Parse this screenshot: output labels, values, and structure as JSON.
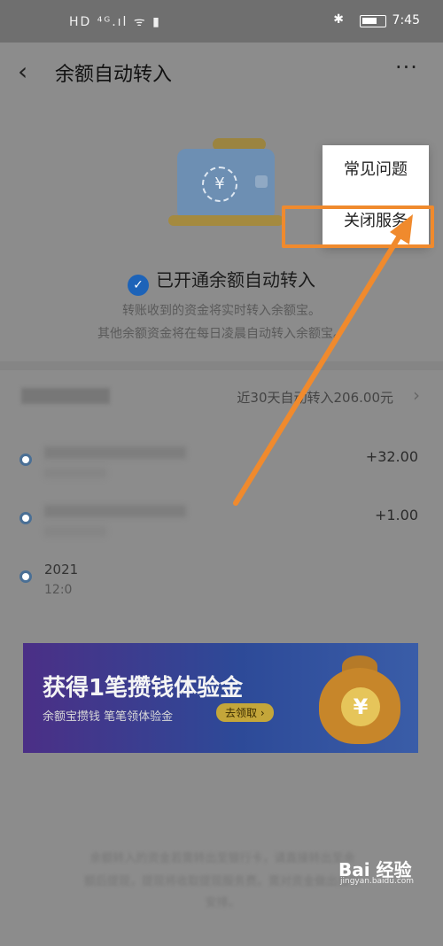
{
  "status_bar": {
    "left_icons": "HD ⁴ᴳ.ıl ᯤ ▮",
    "bluetooth_icon": "✱",
    "time": "7:45"
  },
  "nav": {
    "back_icon": "‹",
    "title": "余额自动转入",
    "more_icon": "···"
  },
  "hero": {
    "status_text": "已开通余额自动转入",
    "sub_line1": "转账收到的资金将实时转入余额宝。",
    "sub_line2": "其他余额资金将在每日凌晨自动转入余额宝。"
  },
  "summary": {
    "text": "近30天自动转入206.00元",
    "chevron": "›"
  },
  "records": [
    {
      "amount": "+32.00"
    },
    {
      "amount": "+1.00"
    },
    {
      "date_prefix": "2021",
      "time_prefix": "12:0"
    }
  ],
  "banner": {
    "title": "获得1笔攒钱体验金",
    "subtitle": "余额宝攒钱 笔笔领体验金",
    "cta": "去领取 ›",
    "yen": "¥"
  },
  "footer": {
    "line1": "余额转入的资金若需转出至银行卡，请直接转出至余",
    "line2": "额后提现，提现将收取提现服务费。需对资金做出自行",
    "line3": "安排。"
  },
  "menu": {
    "faq": "常见问题",
    "close_service": "关闭服务"
  },
  "watermark": {
    "brand": "Bai 经验",
    "url": "jingyan.baidu.com"
  },
  "colors": {
    "highlight": "#f08a2d",
    "accent": "#1d63b8"
  }
}
